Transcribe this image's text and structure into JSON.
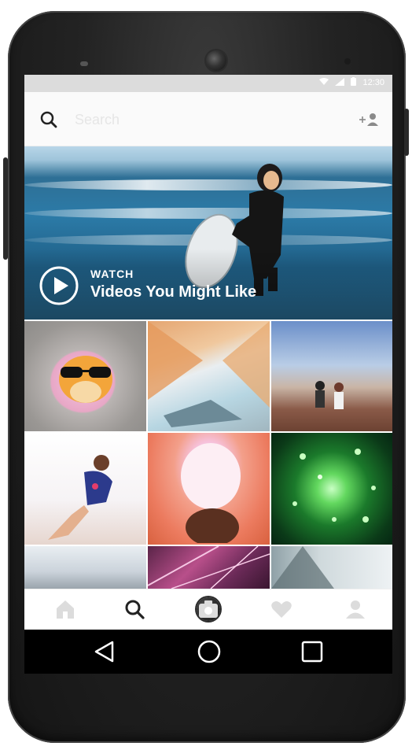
{
  "status_bar": {
    "time": "12:30",
    "icons": [
      "wifi-icon",
      "signal-icon",
      "battery-icon"
    ]
  },
  "search": {
    "placeholder": "Search"
  },
  "hero": {
    "kicker": "WATCH",
    "title": "Videos You Might Like"
  },
  "tab_bar": {
    "tabs": [
      {
        "icon": "home-icon",
        "active": false
      },
      {
        "icon": "search-icon",
        "active": true
      },
      {
        "icon": "camera-icon",
        "active": false
      },
      {
        "icon": "heart-icon",
        "active": false
      },
      {
        "icon": "profile-icon",
        "active": false
      }
    ]
  },
  "android_nav": {
    "buttons": [
      "back-icon",
      "home-circle-icon",
      "recent-apps-icon"
    ]
  },
  "colors": {
    "accent_dark": "#222222",
    "tab_inactive": "#d6d6d6",
    "status_bar": "#dcdcdc"
  }
}
